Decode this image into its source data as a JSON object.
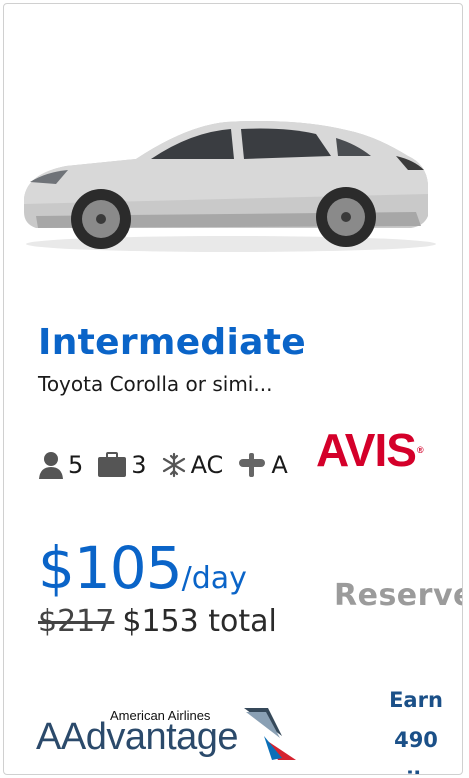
{
  "car": {
    "class_name": "Intermediate",
    "model": "Toyota Corolla or simi..."
  },
  "features": {
    "passengers": "5",
    "bags": "3",
    "ac": "AC",
    "transmission": "A"
  },
  "vendor": {
    "name": "AVIS"
  },
  "pricing": {
    "daily_price": "$105",
    "per_unit": "/day",
    "original_total": "$217",
    "total": "$153 total"
  },
  "actions": {
    "reserve_label": "Reserve"
  },
  "loyalty": {
    "program_small": "American Airlines",
    "program_name": "AAdvantage",
    "earn_label": "Earn",
    "earn_amount": "490",
    "earn_unit": "miles"
  },
  "icons": [
    "person-icon",
    "suitcase-icon",
    "snowflake-icon",
    "transmission-icon"
  ],
  "colors": {
    "accent": "#0a64c8",
    "vendor": "#d4002a",
    "reserve_disabled": "#9b9b9b",
    "loyalty": "#1b5088"
  }
}
